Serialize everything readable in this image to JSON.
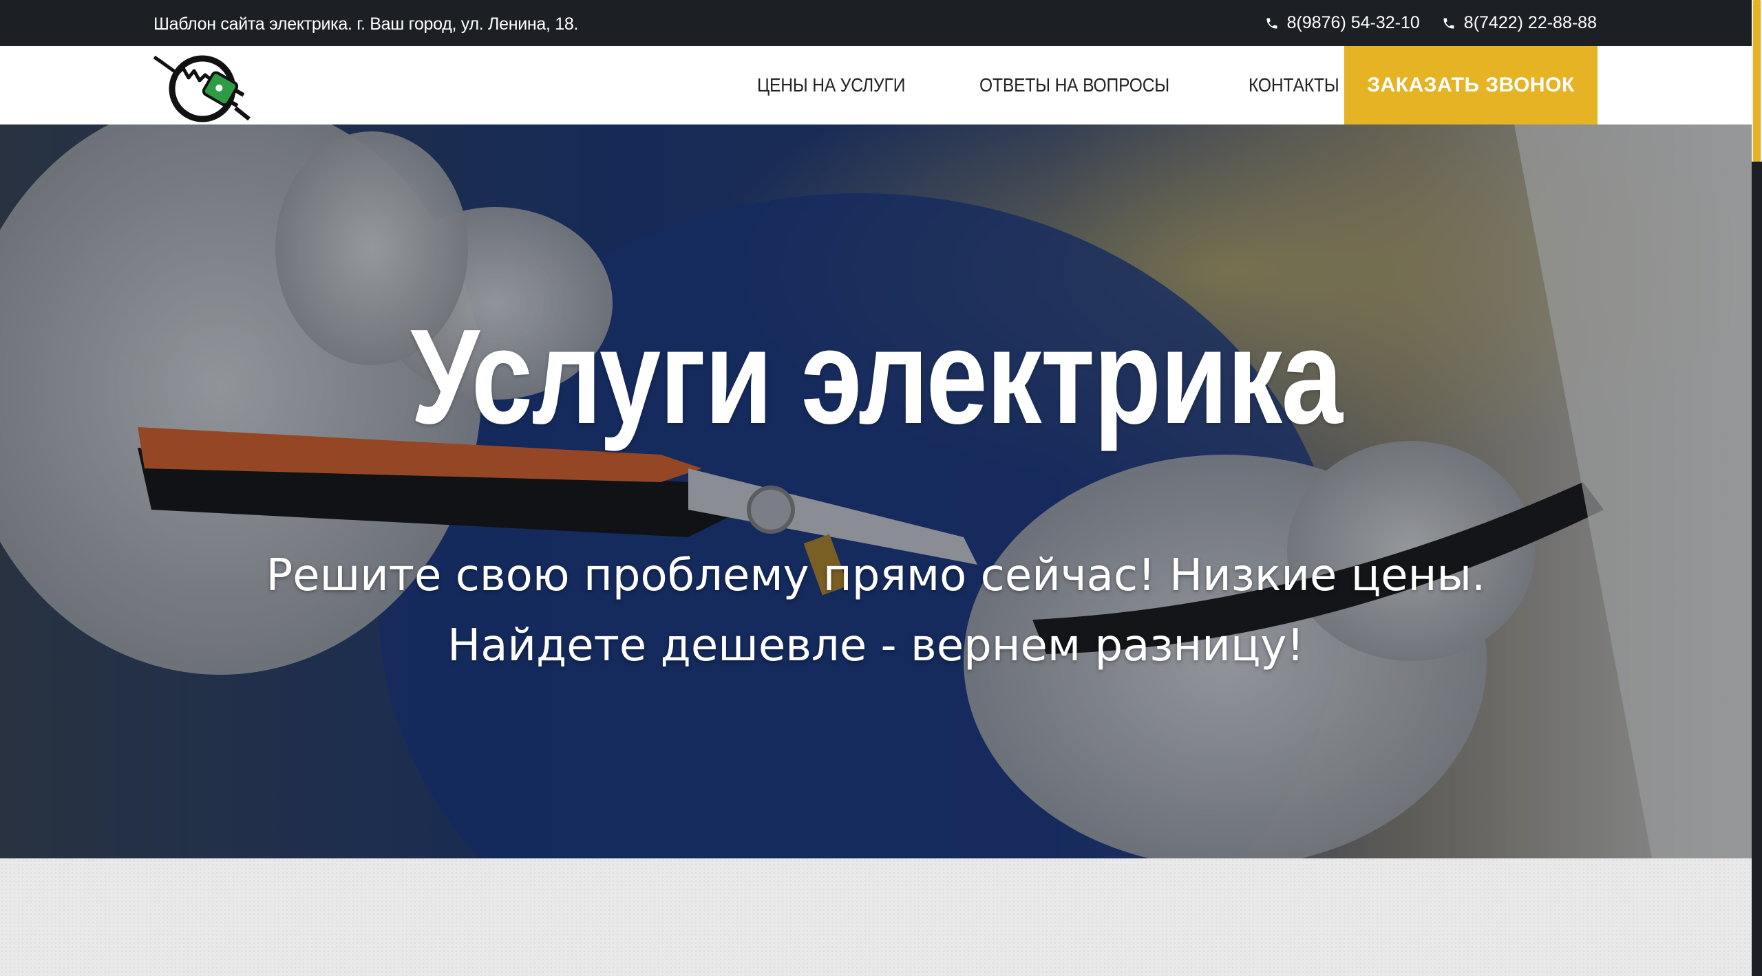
{
  "topbar": {
    "address": "Шаблон сайта электрика. г. Ваш город, ул. Ленина, 18.",
    "phones": [
      {
        "icon": "phone-icon",
        "number": "8(9876) 54-32-10"
      },
      {
        "icon": "phone-icon",
        "number": "8(7422) 22-88-88"
      }
    ]
  },
  "nav": {
    "logo": "electric-plug-logo",
    "links": [
      {
        "label": "ЦЕНЫ НА УСЛУГИ"
      },
      {
        "label": "ОТВЕТЫ НА ВОПРОСЫ"
      },
      {
        "label": "КОНТАКТЫ"
      }
    ],
    "cta_label": "ЗАКАЗАТЬ ЗВОНОК"
  },
  "hero": {
    "title": "Услуги электрика",
    "subtitle_line1": "Решите свою проблему прямо сейчас! Низкие цены.",
    "subtitle_line2": "Найдете дешевле - вернем разницу!"
  },
  "colors": {
    "topbar_bg": "#1c1f24",
    "accent": "#e6b325",
    "nav_bg": "#ffffff",
    "nav_text": "#222222",
    "logo_green": "#2e9b45"
  }
}
